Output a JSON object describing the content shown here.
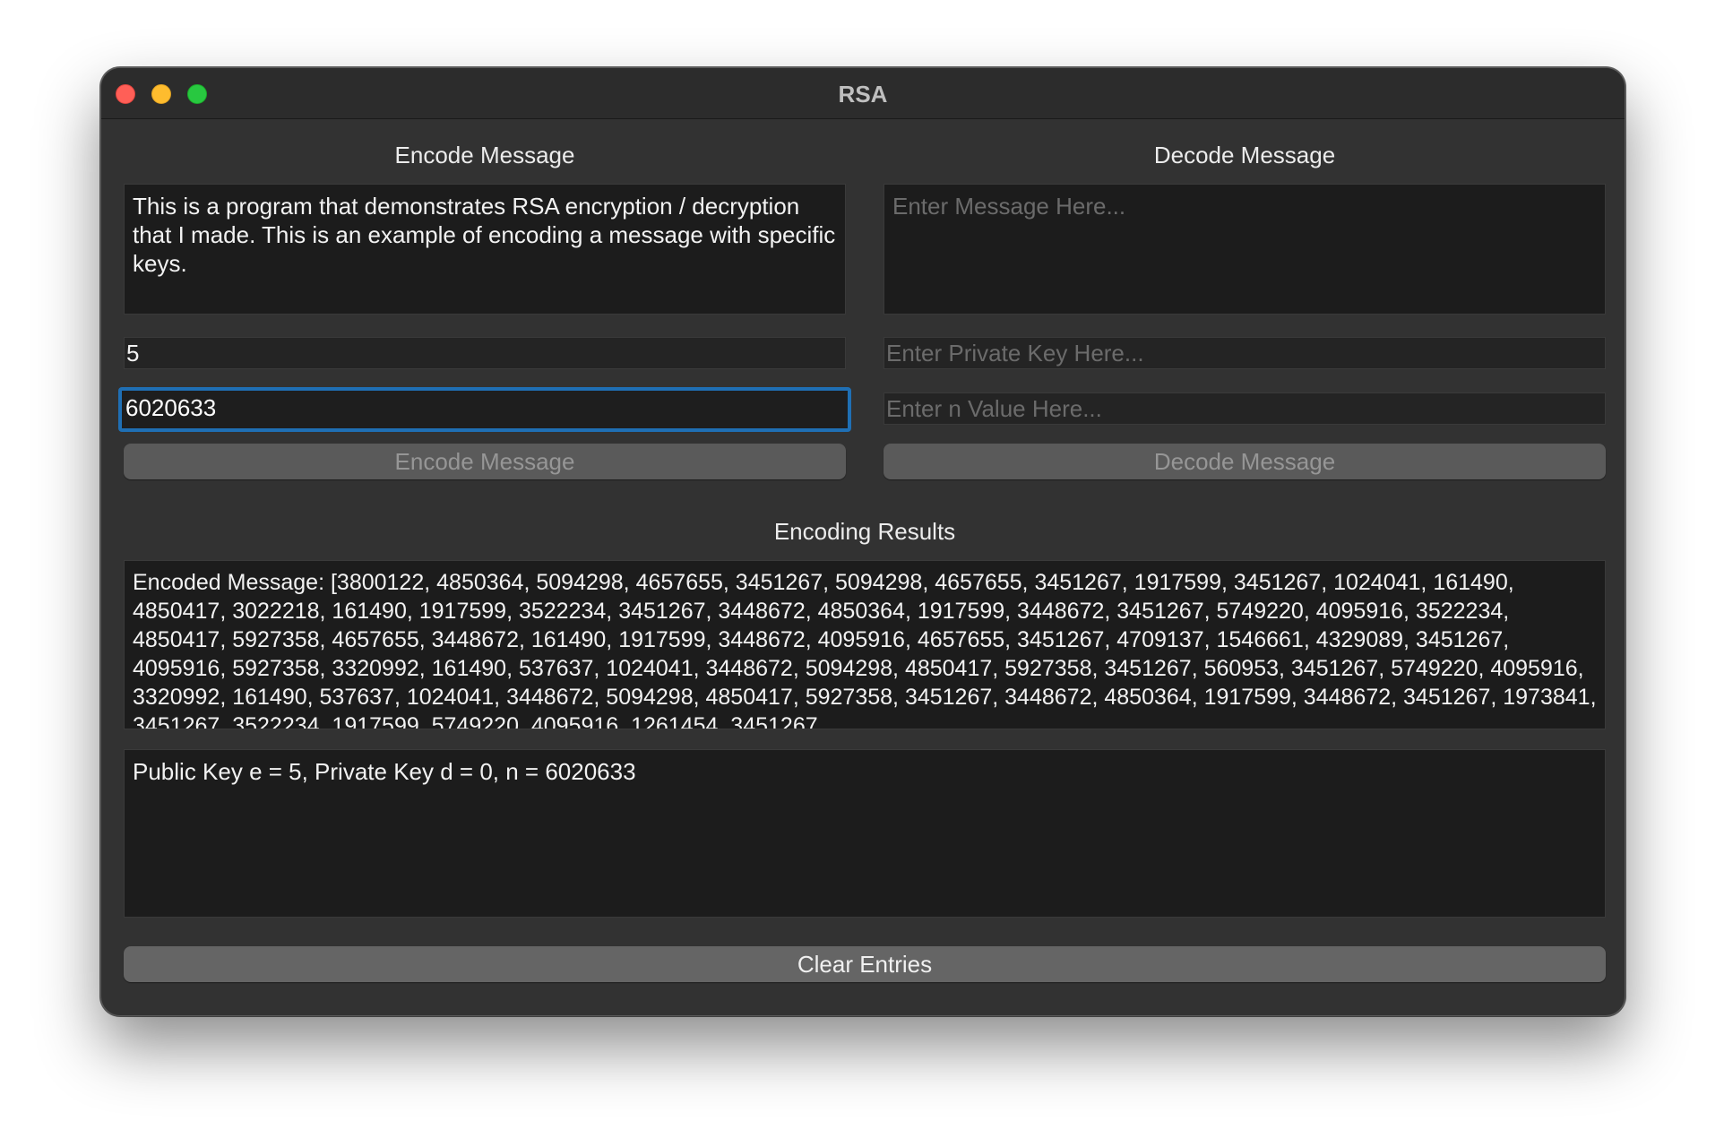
{
  "window": {
    "title": "RSA"
  },
  "encode": {
    "section_title": "Encode Message",
    "message": "This is a program that demonstrates RSA encryption / decryption that I made. This is an example of encoding a message with specific keys.",
    "public_key_value": "5",
    "n_value": "6020633",
    "button_label": "Encode Message"
  },
  "decode": {
    "section_title": "Decode Message",
    "message_placeholder": "Enter Message Here...",
    "private_key_placeholder": "Enter Private Key Here...",
    "n_placeholder": "Enter n Value Here...",
    "button_label": "Decode Message"
  },
  "results": {
    "section_title": "Encoding Results",
    "encoded_message": "Encoded Message: [3800122, 4850364, 5094298, 4657655, 3451267, 5094298, 4657655, 3451267, 1917599, 3451267, 1024041, 161490, 4850417, 3022218, 161490, 1917599, 3522234, 3451267, 3448672, 4850364, 1917599, 3448672, 3451267, 5749220, 4095916, 3522234, 4850417, 5927358, 4657655, 3448672, 161490, 1917599, 3448672, 4095916, 4657655, 3451267, 4709137, 1546661, 4329089, 3451267, 4095916, 5927358, 3320992, 161490, 537637, 1024041, 3448672, 5094298, 4850417, 5927358, 3451267, 560953, 3451267, 5749220, 4095916, 3320992, 161490, 537637, 1024041, 3448672, 5094298, 4850417, 5927358, 3451267, 3448672, 4850364, 1917599, 3448672, 3451267, 1973841, 3451267, 3522234, 1917599, 5749220, 4095916, 1261454, 3451267,",
    "key_info": "Public Key e = 5, Private Key d = 0, n = 6020633"
  },
  "footer": {
    "clear_label": "Clear Entries"
  }
}
